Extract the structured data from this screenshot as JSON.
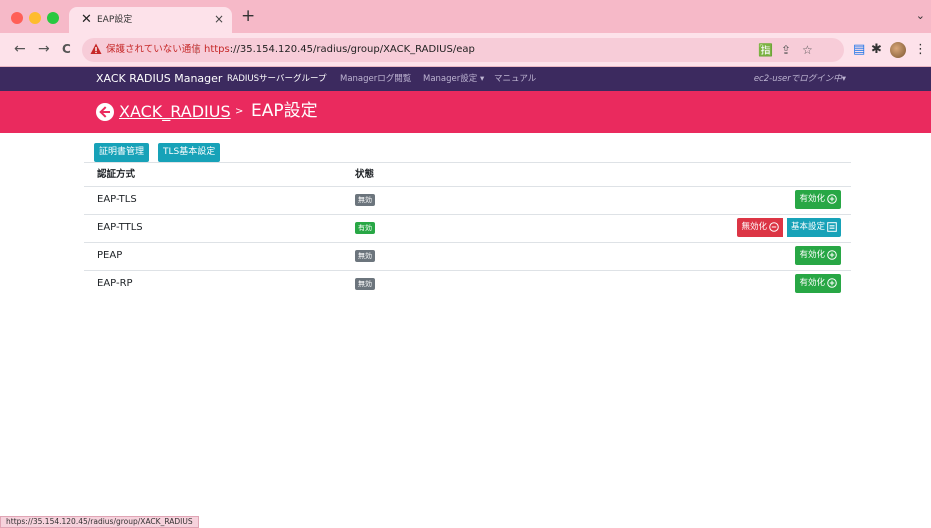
{
  "browser": {
    "tab_favicon": "✕",
    "tab_title": "EAP設定",
    "tab_close": "×",
    "new_tab": "+",
    "tab_dropdown": "⌄",
    "nav": {
      "back": "←",
      "forward": "→",
      "reload": "C"
    },
    "security_warning": "保護されていない通信",
    "url_scheme": "https",
    "url_rest": "://35.154.120.45/radius/group/XACK_RADIUS/eap",
    "url_separator": "|"
  },
  "navbar": {
    "brand": "XACK RADIUS Manager",
    "links": [
      {
        "label": "RADIUSサーバーグループ",
        "active": true
      },
      {
        "label": "Managerログ閲覧",
        "active": false
      },
      {
        "label": "Manager設定 ▾",
        "active": false
      },
      {
        "label": "マニュアル",
        "active": false
      }
    ],
    "user": "ec2-userでログイン中▾"
  },
  "header": {
    "breadcrumb_link": "XACK_RADIUS",
    "separator": ">",
    "title": "EAP設定"
  },
  "actions": {
    "cert_button": "証明書管理",
    "tls_button": "TLS基本設定"
  },
  "table": {
    "columns": [
      "認証方式",
      "状態"
    ],
    "rows": [
      {
        "name": "EAP-TLS",
        "status": "無効",
        "enabled": false,
        "action": "有効化"
      },
      {
        "name": "EAP-TTLS",
        "status": "有効",
        "enabled": true,
        "action": "無効化",
        "settings": "基本設定"
      },
      {
        "name": "PEAP",
        "status": "無効",
        "enabled": false,
        "action": "有効化"
      },
      {
        "name": "EAP-RP",
        "status": "無効",
        "enabled": false,
        "action": "有効化"
      }
    ]
  },
  "status_bar": "https://35.154.120.45/radius/group/XACK_RADIUS",
  "colors": {
    "tabbar": "#f6b9c8",
    "navbar": "#3c2a5f",
    "header": "#ea2a5e",
    "info": "#17a2b8",
    "success": "#28a745",
    "danger": "#dc3545",
    "secondary": "#6c757d"
  }
}
